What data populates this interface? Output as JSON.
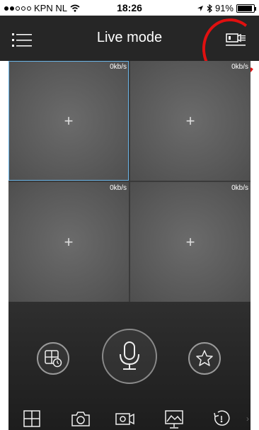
{
  "status_bar": {
    "carrier": "KPN NL",
    "time": "18:26",
    "battery": "91%",
    "battery_level": 0.91
  },
  "nav": {
    "title": "Live mode",
    "left_icon": "menu-list-icon",
    "right_icon": "record-icon"
  },
  "channels": [
    {
      "rate": "0kb/s",
      "selected": true
    },
    {
      "rate": "0kb/s",
      "selected": false
    },
    {
      "rate": "0kb/s",
      "selected": false
    },
    {
      "rate": "0kb/s",
      "selected": false
    }
  ],
  "controls": {
    "left_icon": "playback-icon",
    "center_icon": "microphone-icon",
    "right_icon": "star-icon"
  },
  "toolbar": [
    "split-screen-icon",
    "camera-icon",
    "video-record-icon",
    "image-icon",
    "ptz-icon"
  ],
  "colors": {
    "nav_bg": "#262626",
    "selected_border": "#6ab4e6",
    "highlight_circle": "#e01010"
  }
}
